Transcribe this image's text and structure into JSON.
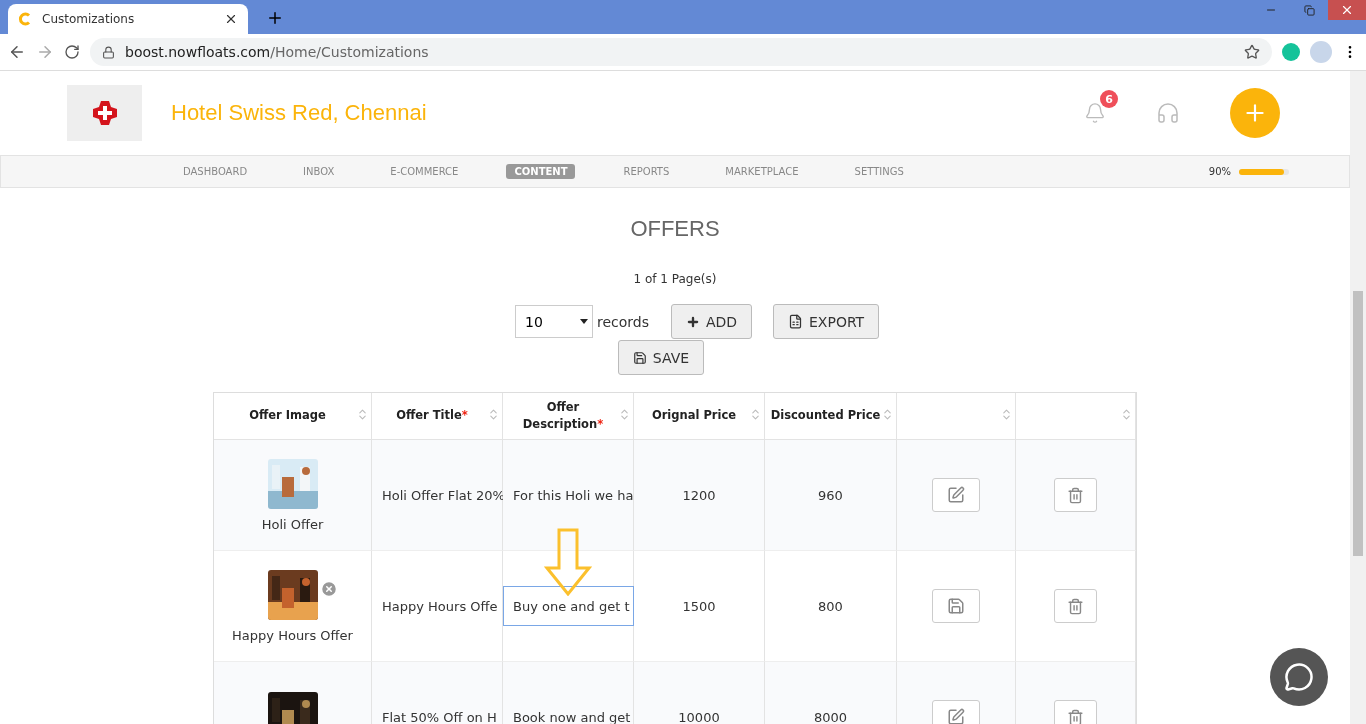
{
  "browser": {
    "tab_title": "Customizations",
    "url_host": "boost.nowfloats.com",
    "url_path": "/Home/Customizations"
  },
  "header": {
    "business_name": "Hotel Swiss Red, Chennai",
    "notification_count": "6"
  },
  "nav": [
    {
      "label": "DASHBOARD",
      "selected": false
    },
    {
      "label": "INBOX",
      "selected": false
    },
    {
      "label": "E-COMMERCE",
      "selected": false
    },
    {
      "label": "CONTENT",
      "selected": true
    },
    {
      "label": "REPORTS",
      "selected": false
    },
    {
      "label": "MARKETPLACE",
      "selected": false
    },
    {
      "label": "SETTINGS",
      "selected": false
    }
  ],
  "profile_completion": {
    "reading": "90%",
    "level": 0.9
  },
  "offers": {
    "title": "OFFERS",
    "pagination": "1 of 1 Page(s)",
    "page_size": "10",
    "page_size_label": "records",
    "buttons": [
      {
        "kind": "add",
        "label": "ADD"
      },
      {
        "kind": "export",
        "label": "EXPORT"
      },
      {
        "kind": "save",
        "label": "SAVE"
      }
    ]
  },
  "table": {
    "columns": [
      {
        "label": "Offer Image",
        "sortable": true
      },
      {
        "label": "Offer Title",
        "required_mark": "*",
        "sortable": true
      },
      {
        "label": "Offer Description",
        "required_mark": "*",
        "sortable": true
      },
      {
        "label": "Orignal Price",
        "sortable": true
      },
      {
        "label": "Discounted Price",
        "sortable": true
      },
      {
        "sortable": true
      },
      {
        "sortable": true
      }
    ],
    "rows": [
      {
        "image_caption": "Holi Offer",
        "title": "Holi Offer Flat 20%",
        "description": "For this Holi we ha",
        "original_price": "1200",
        "discounted_price": "960",
        "editing": false
      },
      {
        "image_caption": "Happy Hours Offer",
        "title": "Happy Hours Offe",
        "description": "Buy one and get t",
        "original_price": "1500",
        "discounted_price": "800",
        "editing": true
      },
      {
        "title": "Flat 50% Off on H",
        "description": "Book now and get",
        "original_price": "10000",
        "discounted_price": "8000",
        "editing": false
      }
    ]
  }
}
